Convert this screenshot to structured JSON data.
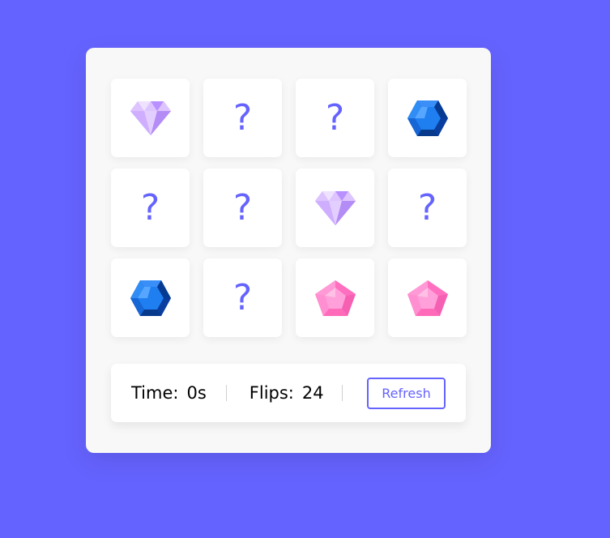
{
  "cards": [
    {
      "state": "revealed",
      "gem": "purple-diamond-gem"
    },
    {
      "state": "hidden",
      "symbol": "?"
    },
    {
      "state": "hidden",
      "symbol": "?"
    },
    {
      "state": "revealed",
      "gem": "blue-hexagon-gem"
    },
    {
      "state": "hidden",
      "symbol": "?"
    },
    {
      "state": "hidden",
      "symbol": "?"
    },
    {
      "state": "revealed",
      "gem": "purple-diamond-gem"
    },
    {
      "state": "hidden",
      "symbol": "?"
    },
    {
      "state": "revealed",
      "gem": "blue-hexagon-gem"
    },
    {
      "state": "hidden",
      "symbol": "?"
    },
    {
      "state": "revealed",
      "gem": "pink-pentagon-gem"
    },
    {
      "state": "revealed",
      "gem": "pink-pentagon-gem"
    }
  ],
  "details": {
    "time_label": "Time:",
    "time_value": "0s",
    "flips_label": "Flips:",
    "flips_value": "24",
    "refresh_label": "Refresh"
  },
  "colors": {
    "background": "#6563ff",
    "accent": "#6563ff",
    "card": "#ffffff",
    "panel": "#f8f8f8"
  }
}
